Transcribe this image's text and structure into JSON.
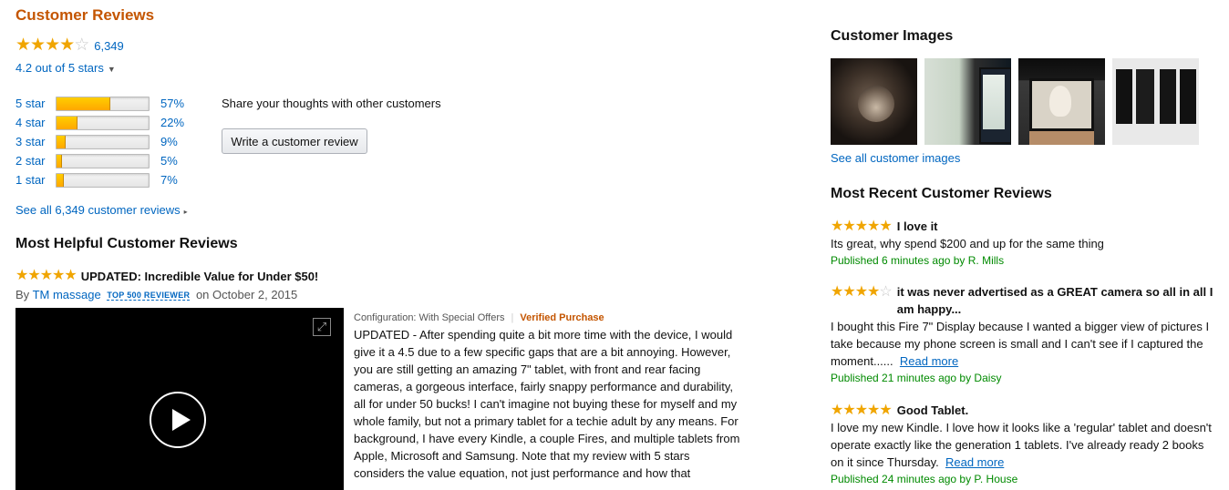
{
  "header": {
    "title": "Customer Reviews"
  },
  "overall": {
    "rating": 4.2,
    "count": "6,349",
    "out_of": "4.2 out of 5 stars"
  },
  "histogram": [
    {
      "label": "5 star",
      "pct": "57%",
      "value": 57
    },
    {
      "label": "4 star",
      "pct": "22%",
      "value": 22
    },
    {
      "label": "3 star",
      "pct": "9%",
      "value": 9
    },
    {
      "label": "2 star",
      "pct": "5%",
      "value": 5
    },
    {
      "label": "1 star",
      "pct": "7%",
      "value": 7
    }
  ],
  "share": {
    "text": "Share your thoughts with other customers",
    "button": "Write a customer review"
  },
  "see_all": "See all 6,349 customer reviews",
  "most_helpful": {
    "heading": "Most Helpful Customer Reviews",
    "review": {
      "rating": 5,
      "title": "UPDATED: Incredible Value for Under $50!",
      "by": "By",
      "author": "TM massage",
      "badge": "TOP 500 REVIEWER",
      "date": "on October 2, 2015",
      "config": "Configuration: With Special Offers",
      "verified": "Verified Purchase",
      "body": "UPDATED - After spending quite a bit more time with the device, I would give it a 4.5 due to a few specific gaps that are a bit annoying. However, you are still getting an amazing 7\" tablet, with front and rear facing cameras, a gorgeous interface, fairly snappy performance and durability, all for under 50 bucks! I can't imagine not buying these for myself and my whole family, but not a primary tablet for a techie adult by any means. For background, I have every Kindle, a couple Fires, and multiple tablets from Apple, Microsoft and Samsung. Note that my review with 5 stars considers the value equation, not just performance and how that"
    }
  },
  "customer_images": {
    "heading": "Customer Images",
    "see_all": "See all customer images"
  },
  "most_recent": {
    "heading": "Most Recent Customer Reviews",
    "reviews": [
      {
        "rating": 5,
        "title": "I love it",
        "body": "Its great, why spend $200 and up for the same thing",
        "read_more": "",
        "published": "Published 6 minutes ago by R. Mills"
      },
      {
        "rating": 4,
        "title": "it was never advertised as a GREAT camera so all in all I am happy...",
        "body": "I bought this Fire 7\" Display because I wanted a bigger view of pictures I take because my phone screen is small and I can't see if I captured the moment......",
        "read_more": "Read more",
        "published": "Published 21 minutes ago by Daisy"
      },
      {
        "rating": 5,
        "title": "Good Tablet.",
        "body": "I love my new Kindle. I love how it looks like a 'regular' tablet and doesn't operate exactly like the generation 1 tablets. I've already ready 2 books on it since Thursday.",
        "read_more": "Read more",
        "published": "Published 24 minutes ago by P. House"
      }
    ]
  },
  "colors": {
    "title": "#c45500",
    "link": "#0066c0",
    "star": "#f0a500",
    "published": "#008a00"
  }
}
